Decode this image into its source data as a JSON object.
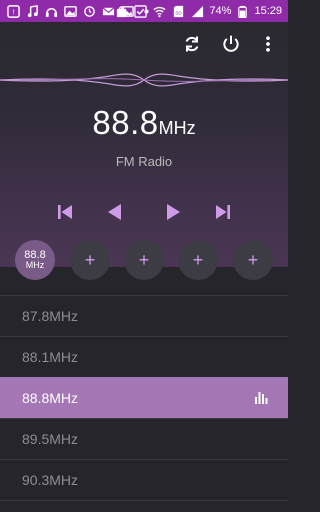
{
  "status_bar": {
    "battery_percent": "74%",
    "time": "15:29",
    "icons_left": [
      "notification-icon",
      "music-icon",
      "headphones-icon",
      "gallery-icon",
      "sync-icon",
      "mail-icon",
      "gallery-icon",
      "more-dots-icon"
    ],
    "icons_right": [
      "bag-icon",
      "check-icon",
      "wifi-icon",
      "sd-icon",
      "signal-icon",
      "battery-icon"
    ]
  },
  "toolbar": {
    "refresh_icon": "refresh-icon",
    "power_icon": "power-icon",
    "menu_icon": "more-vert-icon"
  },
  "tuner": {
    "frequency": "88.8",
    "unit": "MHz",
    "band": "FM Radio"
  },
  "controls": {
    "skip_previous": "skip-previous-icon",
    "seek_back": "seek-back-icon",
    "play": "play-icon",
    "skip_next": "skip-next-icon"
  },
  "presets": [
    {
      "value": "88.8",
      "unit": "MHz",
      "active": true
    },
    {
      "value": "+",
      "active": false
    },
    {
      "value": "+",
      "active": false
    },
    {
      "value": "+",
      "active": false
    },
    {
      "value": "+",
      "active": false
    }
  ],
  "stations": [
    {
      "freq": "87.8",
      "unit": "MHz",
      "active": false
    },
    {
      "freq": "88.1",
      "unit": "MHz",
      "active": false
    },
    {
      "freq": "88.8",
      "unit": "MHz",
      "active": true
    },
    {
      "freq": "89.5",
      "unit": "MHz",
      "active": false
    },
    {
      "freq": "90.3",
      "unit": "MHz",
      "active": false
    }
  ],
  "colors": {
    "status_bar": "#8f2ba8",
    "accent": "#d09be8",
    "active_row": "#a476b5",
    "background": "#26252b"
  }
}
